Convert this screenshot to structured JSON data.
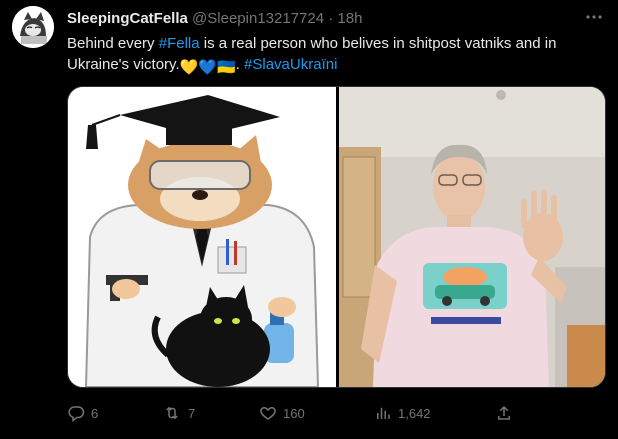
{
  "tweet": {
    "display_name": "SleepingCatFella",
    "handle": "@Sleepin13217724",
    "separator": "·",
    "time": "18h",
    "text": {
      "part1": "Behind every ",
      "hashtag1": "#Fella",
      "part2": " is a real person who belives in shitpost vatniks and in Ukraine's victory.",
      "emoji1": "💛",
      "emoji2": "💙",
      "emoji3": "🇺🇦",
      "part3": ". ",
      "hashtag2": "#SlavaUkraïni"
    },
    "stats": {
      "replies": "6",
      "retweets": "7",
      "likes": "160",
      "views": "1,642"
    },
    "media": [
      {
        "icon": "fella-cat-scientist-image"
      },
      {
        "icon": "woman-photo-image"
      }
    ]
  },
  "colors": {
    "background": "#000000",
    "text": "#e7e9ea",
    "muted": "#71767b",
    "accent": "#1d9bf0"
  }
}
